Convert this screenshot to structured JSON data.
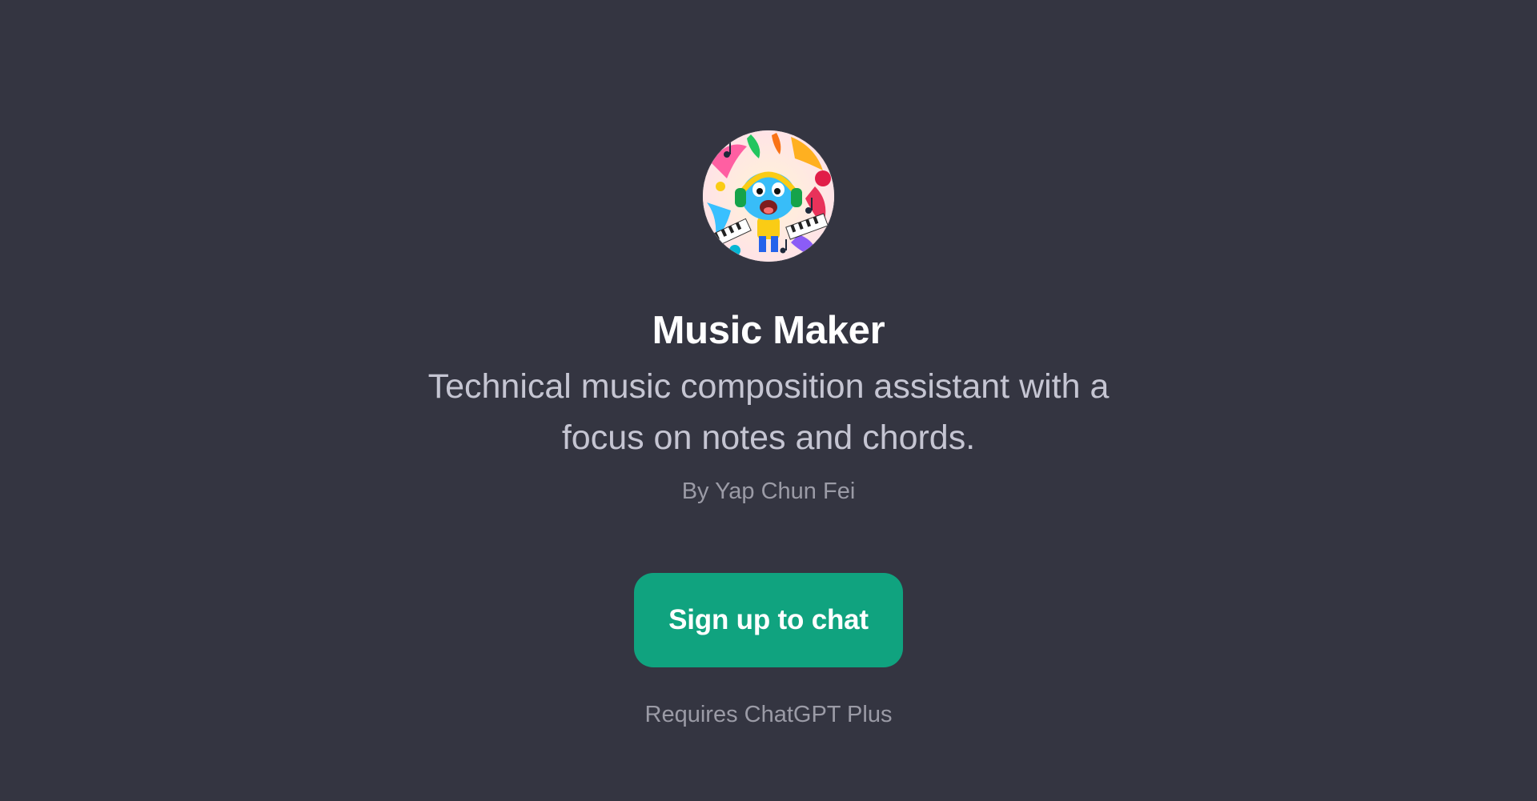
{
  "gpt": {
    "name": "Music Maker",
    "description": "Technical music composition assistant with a focus on notes and chords.",
    "author": "By Yap Chun Fei"
  },
  "cta": {
    "label": "Sign up to chat",
    "note": "Requires ChatGPT Plus"
  },
  "colors": {
    "background": "#343541",
    "button": "#10a37f",
    "title": "#ffffff",
    "description": "#c5c5d2",
    "muted": "#9b9ba6"
  },
  "icons": {
    "avatar": "music-maker-avatar-illustration"
  }
}
